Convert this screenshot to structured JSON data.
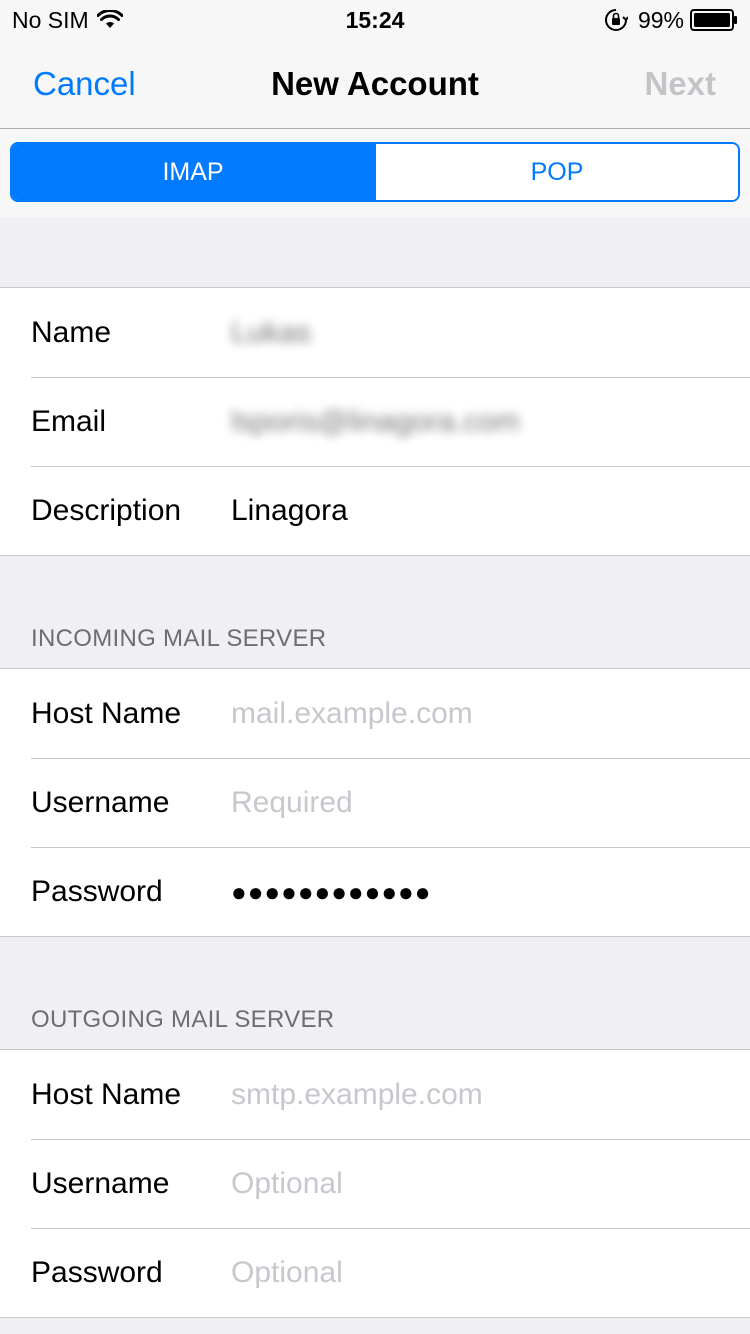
{
  "status_bar": {
    "carrier": "No SIM",
    "time": "15:24",
    "battery": "99%"
  },
  "nav": {
    "cancel": "Cancel",
    "title": "New Account",
    "next": "Next"
  },
  "segments": {
    "imap": "IMAP",
    "pop": "POP",
    "selected": "IMAP"
  },
  "account": {
    "name_label": "Name",
    "name_value": "Lukas",
    "email_label": "Email",
    "email_value": "lsporis@linagora.com",
    "description_label": "Description",
    "description_value": "Linagora"
  },
  "incoming": {
    "header": "INCOMING MAIL SERVER",
    "host_label": "Host Name",
    "host_placeholder": "mail.example.com",
    "username_label": "Username",
    "username_placeholder": "Required",
    "password_label": "Password",
    "password_value": "●●●●●●●●●●●●"
  },
  "outgoing": {
    "header": "OUTGOING MAIL SERVER",
    "host_label": "Host Name",
    "host_placeholder": "smtp.example.com",
    "username_label": "Username",
    "username_placeholder": "Optional",
    "password_label": "Password",
    "password_placeholder": "Optional"
  },
  "colors": {
    "accent": "#007aff",
    "placeholder": "#c7c7cd",
    "background": "#efeff4"
  }
}
